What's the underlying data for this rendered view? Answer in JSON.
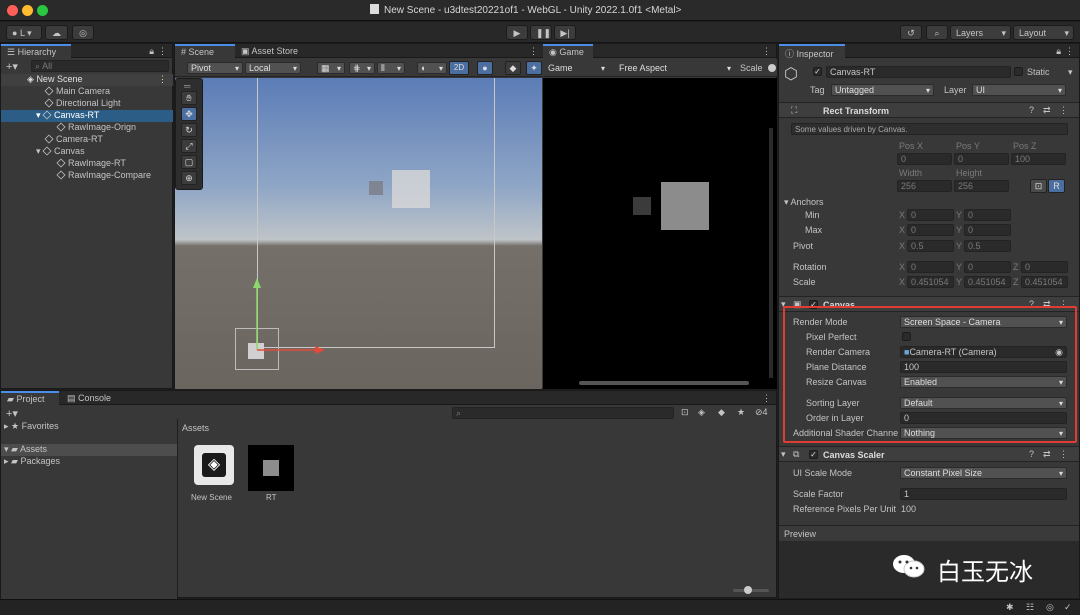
{
  "window": {
    "title": "New Scene - u3dtest20221of1 - WebGL - Unity 2022.1.0f1 <Metal>"
  },
  "toolbar": {
    "account": "L",
    "layers": "Layers",
    "layout": "Layout"
  },
  "hierarchy": {
    "tab": "Hierarchy",
    "search_placeholder": "All",
    "scene": "New Scene",
    "items": [
      "Main Camera",
      "Directional Light",
      "Canvas-RT",
      "RawImage-Orign",
      "Camera-RT",
      "Canvas",
      "RawImage-RT",
      "RawImage-Compare"
    ]
  },
  "scene": {
    "tab": "Scene",
    "asset_store": "Asset Store",
    "pivot": "Pivot",
    "local": "Local",
    "mode2d": "2D"
  },
  "game": {
    "tab": "Game",
    "display": "Game",
    "aspect": "Free Aspect",
    "scale": "Scale"
  },
  "project": {
    "tab": "Project",
    "console": "Console",
    "favorites": "Favorites",
    "assets": "Assets",
    "packages": "Packages",
    "breadcrumb": "Assets",
    "files": [
      "New Scene",
      "RT"
    ],
    "badge": "4"
  },
  "inspector": {
    "tab": "Inspector",
    "name": "Canvas-RT",
    "static": "Static",
    "tag_label": "Tag",
    "tag": "Untagged",
    "layer_label": "Layer",
    "layer": "UI",
    "rect": {
      "title": "Rect Transform",
      "note": "Some values driven by Canvas.",
      "pos_x_label": "Pos X",
      "pos_y_label": "Pos Y",
      "pos_z_label": "Pos Z",
      "pos_x": "0",
      "pos_y": "0",
      "pos_z": "100",
      "width_label": "Width",
      "height_label": "Height",
      "width": "256",
      "height": "256",
      "r": "R",
      "anchors": "Anchors",
      "min": "Min",
      "max": "Max",
      "x": "X",
      "y": "Y",
      "z": "Z",
      "min_x": "0",
      "min_y": "0",
      "max_x": "0",
      "max_y": "0",
      "pivot": "Pivot",
      "pivot_x": "0.5",
      "pivot_y": "0.5",
      "rotation": "Rotation",
      "rot_x": "0",
      "rot_y": "0",
      "rot_z": "0",
      "scale": "Scale",
      "scale_x": "0.451054",
      "scale_y": "0.451054",
      "scale_z": "0.451054"
    },
    "canvas": {
      "title": "Canvas",
      "render_mode_label": "Render Mode",
      "render_mode": "Screen Space - Camera",
      "pixel_perfect_label": "Pixel Perfect",
      "render_camera_label": "Render Camera",
      "render_camera": "Camera-RT (Camera)",
      "plane_distance_label": "Plane Distance",
      "plane_distance": "100",
      "resize_canvas_label": "Resize Canvas",
      "resize_canvas": "Enabled",
      "sorting_layer_label": "Sorting Layer",
      "sorting_layer": "Default",
      "order_label": "Order in Layer",
      "order": "0",
      "shader_label": "Additional Shader Channe",
      "shader": "Nothing"
    },
    "scaler": {
      "title": "Canvas Scaler",
      "ui_scale_label": "UI Scale Mode",
      "ui_scale": "Constant Pixel Size",
      "scale_factor_label": "Scale Factor",
      "scale_factor": "1",
      "ref_ppu_label": "Reference Pixels Per Unit",
      "ref_ppu": "100"
    },
    "preview": "Preview"
  },
  "watermark": {
    "text": "白玉无冰"
  },
  "colors": {
    "accent": "#4b8ee8",
    "highlight": "#e03c31",
    "selection": "#2c5d87"
  }
}
